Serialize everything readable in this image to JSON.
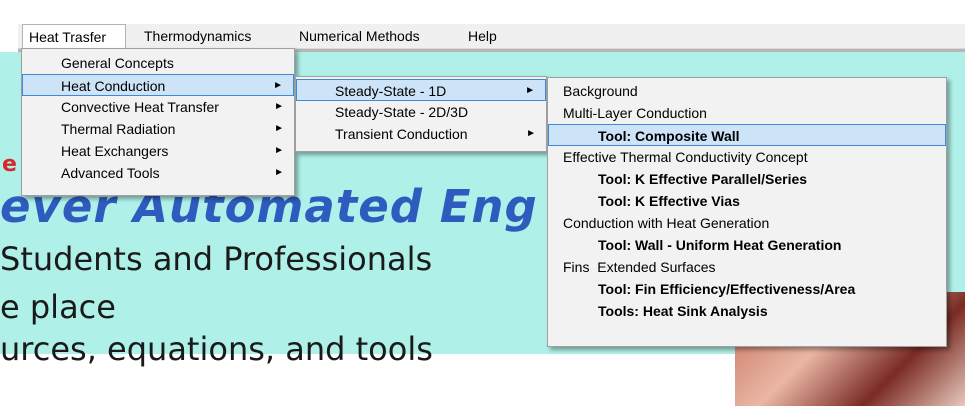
{
  "menubar": {
    "items": [
      {
        "label": "Heat Trasfer"
      },
      {
        "label": "Thermodynamics"
      },
      {
        "label": "Numerical Methods"
      },
      {
        "label": "Help"
      }
    ]
  },
  "background": {
    "red_letter": "e",
    "hero_title": "ever Automated Eng",
    "line1": "Students and Professionals",
    "line2": "e place",
    "line3": "urces, equations, and tools"
  },
  "menu_heat_transfer": {
    "items": [
      {
        "label": "General Concepts"
      },
      {
        "label": "Heat Conduction",
        "arrow": "►"
      },
      {
        "label": "Convective Heat Transfer",
        "arrow": "►"
      },
      {
        "label": "Thermal Radiation",
        "arrow": "►"
      },
      {
        "label": "Heat Exchangers",
        "arrow": "►"
      },
      {
        "label": "Advanced Tools",
        "arrow": "►"
      }
    ]
  },
  "menu_heat_conduction": {
    "items": [
      {
        "label": "Steady-State - 1D",
        "arrow": "►"
      },
      {
        "label": "Steady-State - 2D/3D"
      },
      {
        "label": "Transient Conduction",
        "arrow": "►"
      }
    ]
  },
  "menu_steady_1d": {
    "items": [
      {
        "label": "Background"
      },
      {
        "label": "Multi-Layer Conduction"
      },
      {
        "label": "Tool: Composite Wall"
      },
      {
        "label": "Effective Thermal Conductivity Concept"
      },
      {
        "label": "Tool: K Effective Parallel/Series"
      },
      {
        "label": "Tool: K Effective Vias"
      },
      {
        "label": "Conduction with Heat Generation"
      },
      {
        "label": "Tool: Wall - Uniform Heat Generation"
      },
      {
        "label": "Fins  Extended Surfaces"
      },
      {
        "label": "Tool: Fin Efficiency/Effectiveness/Area"
      },
      {
        "label": "Tools: Heat Sink Analysis"
      }
    ]
  }
}
